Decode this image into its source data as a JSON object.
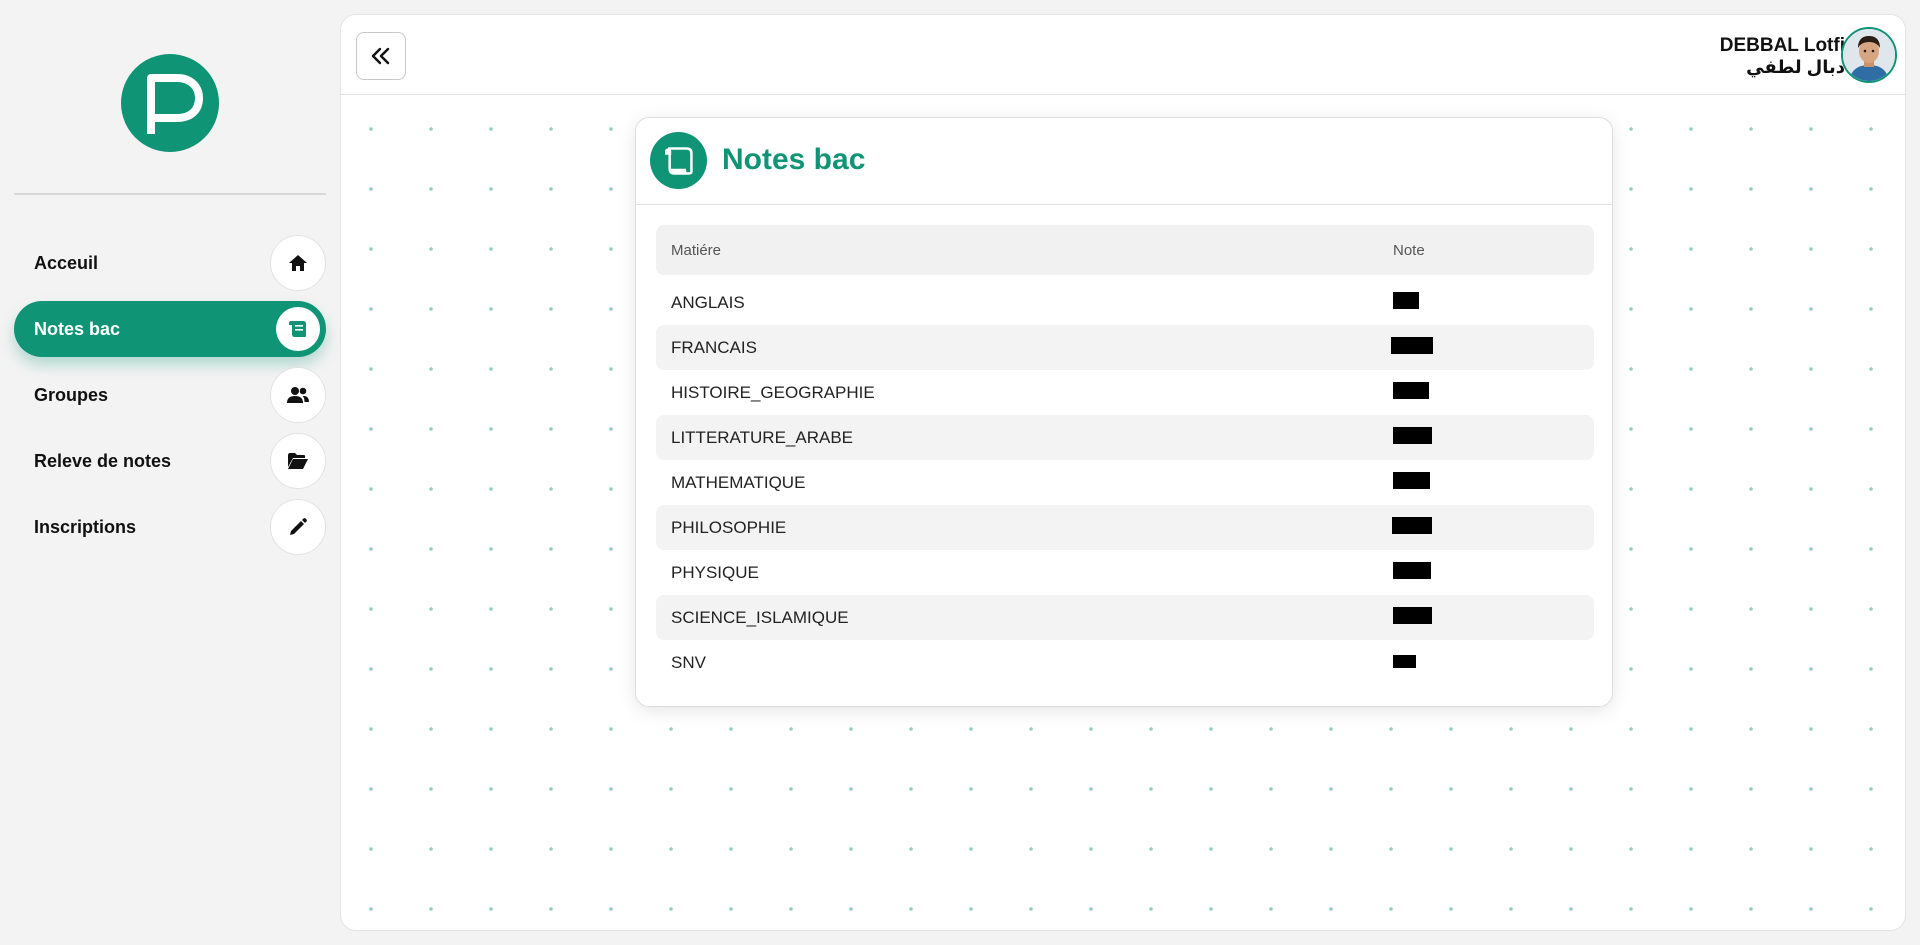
{
  "sidebar": {
    "logo_icon": "p-logo-icon",
    "items": [
      {
        "label": "Acceuil",
        "icon": "home-icon",
        "active": false
      },
      {
        "label": "Notes bac",
        "icon": "scroll-icon",
        "active": true
      },
      {
        "label": "Groupes",
        "icon": "users-icon",
        "active": false
      },
      {
        "label": "Releve de notes",
        "icon": "folder-open-icon",
        "active": false
      },
      {
        "label": "Inscriptions",
        "icon": "pencil-icon",
        "active": false
      }
    ]
  },
  "topbar": {
    "collapse_icon": "double-chevron-left-icon",
    "user": {
      "name": "DEBBAL Lotfi",
      "name_ar": "دبال لطفي"
    }
  },
  "card": {
    "title": "Notes bac",
    "icon": "scroll-icon",
    "columns": [
      "Matiére",
      "Note"
    ],
    "rows": [
      {
        "matiere": "ANGLAIS",
        "note": "[redacted]"
      },
      {
        "matiere": "FRANCAIS",
        "note": "[redacted]"
      },
      {
        "matiere": "HISTOIRE_GEOGRAPHIE",
        "note": "[redacted]"
      },
      {
        "matiere": "LITTERATURE_ARABE",
        "note": "[redacted]"
      },
      {
        "matiere": "MATHEMATIQUE",
        "note": "[redacted]"
      },
      {
        "matiere": "PHILOSOPHIE",
        "note": "[redacted]"
      },
      {
        "matiere": "PHYSIQUE",
        "note": "[redacted]"
      },
      {
        "matiere": "SCIENCE_ISLAMIQUE",
        "note": "[redacted]"
      },
      {
        "matiere": "SNV",
        "note": "[redacted]"
      }
    ]
  },
  "colors": {
    "accent": "#0f9475",
    "background": "#f3f3f3"
  }
}
